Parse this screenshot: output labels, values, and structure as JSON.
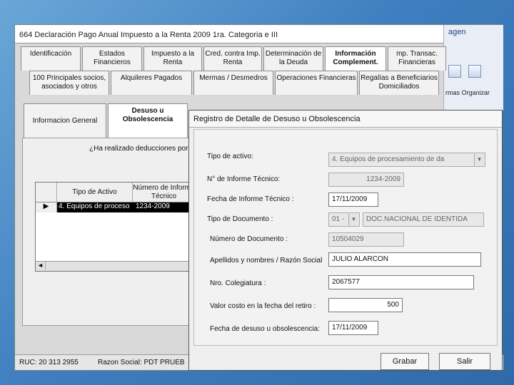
{
  "app": {
    "title": "664 Declaración Pago Anual Impuesto a la Renta 2009 1ra. Categoria e III",
    "ribbon": {
      "tab": "agen",
      "labels": "rmas  Organizar"
    },
    "tabs_row1": [
      "Identificación",
      "Estados Financieros",
      "Impuesto a la Renta",
      "Cred. contra Imp. Renta",
      "Determinación de la Deuda",
      "Información Complement.",
      "mp. Transac. Financieras"
    ],
    "tabs_row2": [
      "100 Principales socios, asociados y otros",
      "Alquileres Pagados",
      "Mermas / Desmedros",
      "Operaciones Financieras",
      "Regalías a Beneficiarios Domiciliados"
    ],
    "tabs_row3": [
      "Informacion General",
      "Desuso u Obsolescencia"
    ],
    "question": "¿Ha realizado deducciones por",
    "grid": {
      "headers": [
        "",
        "Tipo de Activo",
        "Número de Informe Técnico"
      ],
      "row": [
        "4. Equipos de proceso",
        "1234-2009"
      ],
      "scroll_left": "◄"
    },
    "status": {
      "ruc": "RUC: 20 313 2955",
      "razon": "Razon Social: PDT PRUEB"
    }
  },
  "dialog": {
    "title": "Registro de Detalle de Desuso u Obsolescencia",
    "fields": {
      "tipo_activo_label": "Tipo de activo:",
      "tipo_activo_value": "4. Equipos de procesamiento de da",
      "informe_label": "N° de Informe Técnico:",
      "informe_value": "1234-2009",
      "fecha_informe_label": "Fecha de Informe Técnico :",
      "fecha_informe_value": "17/11/2009",
      "tipo_doc_label": "Tipo de Documento :",
      "tipo_doc_code": "01 - ",
      "tipo_doc_name": "DOC.NACIONAL DE IDENTIDA",
      "num_doc_label": "Número de Documento :",
      "num_doc_value": "10504029",
      "apellidos_label": "Apellidos y nombres / Razón Social",
      "apellidos_value": "JULIO ALARCON",
      "colegiatura_label": "Nro. Colegiatura :",
      "colegiatura_value": "2067577",
      "valor_label": "Valor costo en la fecha del retiro :",
      "valor_value": "500",
      "fecha_desuso_label": "Fecha de desuso u obsolescencia:",
      "fecha_desuso_value": "17/11/2009"
    },
    "buttons": {
      "save": "Grabar",
      "exit": "Salir"
    }
  }
}
